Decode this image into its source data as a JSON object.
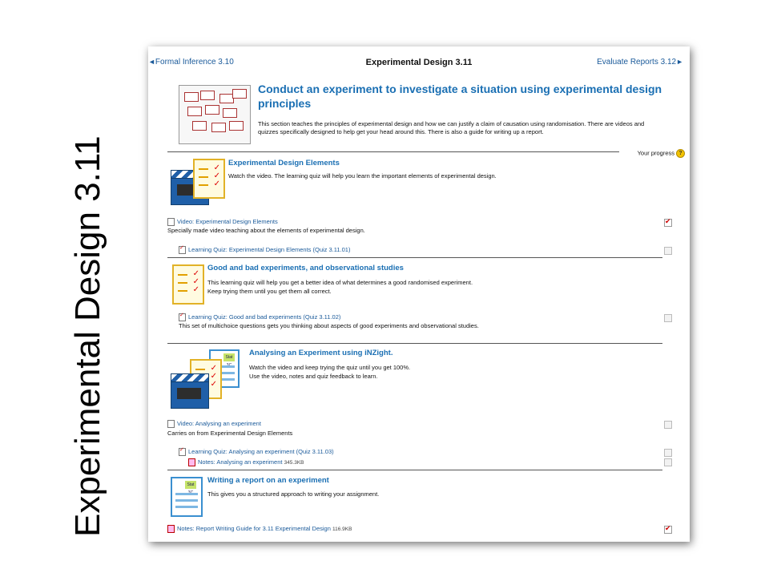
{
  "slide_title": "Experimental Design 3.11",
  "nav": {
    "prev_label": "Formal Inference 3.10",
    "current_title": "Experimental Design 3.11",
    "next_label": "Evaluate Reports 3.12",
    "prev_arrow": "◄",
    "next_arrow": "►"
  },
  "hero": {
    "title": "Conduct an experiment to investigate a situation using experimental design principles",
    "description": "This section teaches the principles of experimental design and how we can justify a claim of causation using randomisation. There are videos and quizzes specifically designed to help get your head around this. There is also a guide for writing up a report."
  },
  "progress": {
    "label": "Your progress",
    "help_icon": "question-icon",
    "help_glyph": "?"
  },
  "sections": [
    {
      "title": "Experimental Design Elements",
      "text": "Watch the video. The learning quiz will help you learn the important elements of experimental design.",
      "items": [
        {
          "label": "Video: Experimental Design Elements",
          "note": "Specially made video teaching about the elements of experimental design.",
          "checked": true
        },
        {
          "label": "Learning Quiz: Experimental Design Elements (Quiz 3.11.01)",
          "checked": false
        }
      ]
    },
    {
      "title": "Good and bad experiments, and observational studies",
      "text1": "This learning quiz will help you get a better idea of what determines a good randomised experiment.",
      "text2": "Keep trying them until you get them all correct.",
      "items": [
        {
          "label": "Learning Quiz: Good and bad experiments (Quiz 3.11.02)",
          "note": "This set of multichoice questions gets you thinking about aspects of good experiments and observational studies.",
          "checked": false
        }
      ]
    },
    {
      "title": "Analysing an Experiment using iNZight.",
      "text1": "Watch the video and keep trying the quiz until you get 100%.",
      "text2": "Use the video, notes and quiz feedback to learn.",
      "items": [
        {
          "label": "Video: Analysing an experiment",
          "note": "Carries on from Experimental Design Elements",
          "checked": false
        },
        {
          "label": "Learning Quiz: Analysing an experiment (Quiz 3.11.03)",
          "checked": false
        },
        {
          "label": "Notes: Analysing an experiment",
          "size": "345.3KB",
          "checked": false
        }
      ]
    },
    {
      "title": "Writing a report on an experiment",
      "text": "This gives you a structured approach to writing your assignment.",
      "items": [
        {
          "label": "Notes: Report Writing Guide for 3.11 Experimental Design",
          "size": "116.9KB",
          "checked": true
        }
      ]
    }
  ],
  "stat_badge": "Stat 3C",
  "colors": {
    "link": "#1a5a9a",
    "heading": "#1a6fb3",
    "check": "#cc0000"
  }
}
